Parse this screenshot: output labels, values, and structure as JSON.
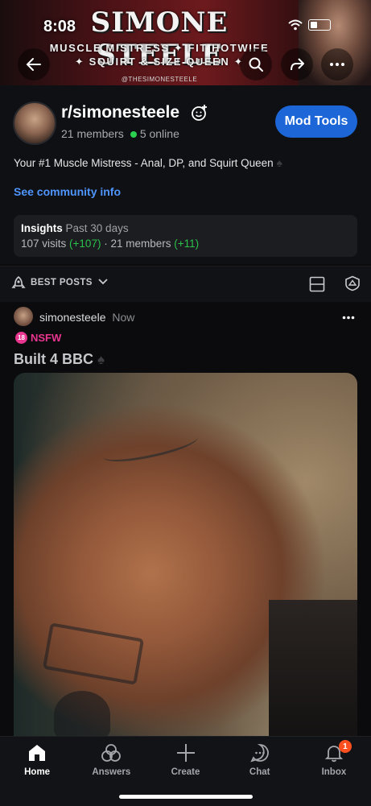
{
  "status_bar": {
    "time": "8:08"
  },
  "banner": {
    "title": "SIMONE STEELE",
    "tagline_1": "MUSCLE MISTRESS ✦ FIT HOTWIFE",
    "tagline_2": "✦ SQUIRT & SIZE QUEEN ✦",
    "handle": "@THESIMONESTEELE"
  },
  "community": {
    "name": "r/simonesteele",
    "members": "21 members",
    "online": "5 online",
    "mod_tools_label": "Mod Tools",
    "description": "Your #1 Muscle Mistress - Anal, DP, and Squirt Queen",
    "info_link": "See community info",
    "insights": {
      "title": "Insights",
      "period": "Past 30 days",
      "visits": "107 visits",
      "visits_delta": "(+107)",
      "members": "21 members",
      "members_delta": "(+11)"
    }
  },
  "sort": {
    "label": "BEST POSTS"
  },
  "post": {
    "author": "simonesteele",
    "time": "Now",
    "nsfw_label": "NSFW",
    "nsfw_badge": "18",
    "title": "Built 4 BBC"
  },
  "bottom_nav": {
    "items": [
      {
        "label": "Home",
        "icon": "home-icon"
      },
      {
        "label": "Answers",
        "icon": "answers-icon"
      },
      {
        "label": "Create",
        "icon": "plus-icon"
      },
      {
        "label": "Chat",
        "icon": "chat-icon"
      },
      {
        "label": "Inbox",
        "icon": "bell-icon",
        "badge": "1"
      }
    ]
  },
  "colors": {
    "accent_blue": "#1c66d8",
    "link_blue": "#4f95ff",
    "online_green": "#2bd04f",
    "nsfw_pink": "#e8358f",
    "badge_orange": "#ff4f1f"
  }
}
